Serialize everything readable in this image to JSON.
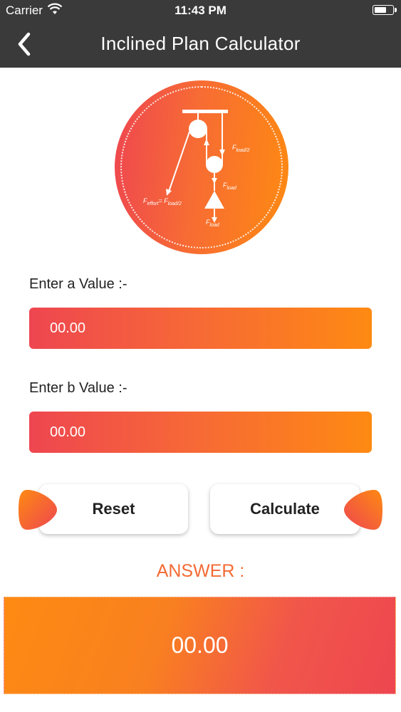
{
  "status_bar": {
    "carrier": "Carrier",
    "time": "11:43 PM"
  },
  "nav": {
    "title": "Inclined Plan Calculator",
    "back_icon": "chevron-left-icon"
  },
  "logo": {
    "labels": {
      "f_load_half": "F",
      "f_load_half_sub": "load/2",
      "f_load_mid": "F",
      "f_load_mid_sub": "load",
      "f_effort": "F",
      "f_effort_sub": "effort",
      "f_effort_eq": "= F",
      "f_effort_eq_sub": "load/2",
      "f_load_bottom": "F",
      "f_load_bottom_sub": "load"
    }
  },
  "form": {
    "a_label": "Enter a Value :-",
    "a_placeholder": "00.00",
    "b_label": "Enter b Value :-",
    "b_placeholder": "00.00"
  },
  "buttons": {
    "reset_label": "Reset",
    "calculate_label": "Calculate"
  },
  "answer": {
    "label": "ANSWER :",
    "value": "00.00"
  },
  "colors": {
    "nav_bg": "#3a3a3a",
    "gradient_red": "#ee4650",
    "gradient_orange": "#fe8a12",
    "answer_label": "#f36a34"
  }
}
